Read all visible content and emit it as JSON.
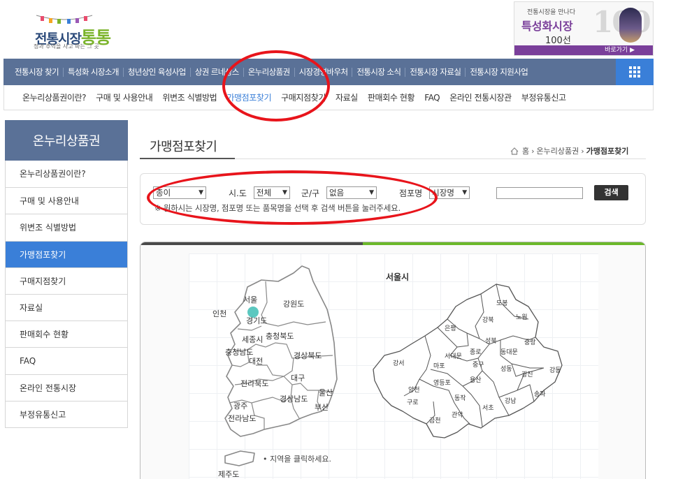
{
  "header": {
    "logo_text": "전통시장",
    "logo_accent": "통통",
    "logo_tagline": "정과 추억을 사고 파는 그 곳",
    "banner": {
      "line1": "전통시장을 만나다",
      "line2": "특성화시장",
      "line3": "100선",
      "number": "100",
      "button": "바로가기 ▶"
    }
  },
  "nav": {
    "items": [
      "전통시장 찾기",
      "특성화 시장소개",
      "청년상인 육성사업",
      "상권 르네상스",
      "온누리상품권",
      "시장경영바우처",
      "전통시장 소식",
      "전통시장 자료실",
      "전통시장 지원사업"
    ]
  },
  "subnav": {
    "items": [
      "온누리상품권이란?",
      "구매 및 사용안내",
      "위변조 식별방법",
      "가맹점포찾기",
      "구매지점찾기",
      "자료실",
      "판매회수 현황",
      "FAQ",
      "온라인 전통시장관",
      "부정유통신고"
    ],
    "active_index": 3
  },
  "sidebar": {
    "title": "온누리상품권",
    "items": [
      "온누리상품권이란?",
      "구매 및 사용안내",
      "위변조 식별방법",
      "가맹점포찾기",
      "구매지점찾기",
      "자료실",
      "판매회수 현황",
      "FAQ",
      "온라인 전통시장",
      "부정유통신고"
    ],
    "active_index": 3
  },
  "content": {
    "title": "가맹점포찾기",
    "breadcrumb": [
      "홈",
      "온누리상품권",
      "가맹점포찾기"
    ]
  },
  "search": {
    "type_select": "종이",
    "sido_label": "시.도",
    "sido_select": "전체",
    "gugun_label": "군/구",
    "gugun_select": "없음",
    "store_label": "점포명",
    "store_select": "시장명",
    "keyword_value": "",
    "button": "검색",
    "note": "※ 원하시는 시장명, 점포명 또는 품목명을 선택 후 검색 버튼을 눌러주세요."
  },
  "map": {
    "korea_regions": [
      "서울",
      "인천",
      "경기도",
      "강원도",
      "충청북도",
      "세종시",
      "충청남도",
      "대전",
      "경상북도",
      "전라북도",
      "대구",
      "울산",
      "경상남도",
      "부산",
      "광주",
      "전라남도",
      "제주도"
    ],
    "seoul_title": "서울시",
    "seoul_districts": [
      "도봉",
      "강북",
      "노원",
      "은평",
      "성북",
      "중랑",
      "서대문",
      "종로",
      "동대문",
      "강서",
      "마포",
      "중구",
      "성동",
      "광진",
      "강동",
      "양천",
      "영등포",
      "용산",
      "구로",
      "동작",
      "강남",
      "송파",
      "금천",
      "관악",
      "서초"
    ],
    "hint": "• 지역을 클릭하세요.",
    "highlight_color": "#5cc8c0"
  },
  "colors": {
    "nav_bg": "#5a7197",
    "accent_blue": "#3a7fd8",
    "annotation_red": "#e8141b"
  }
}
